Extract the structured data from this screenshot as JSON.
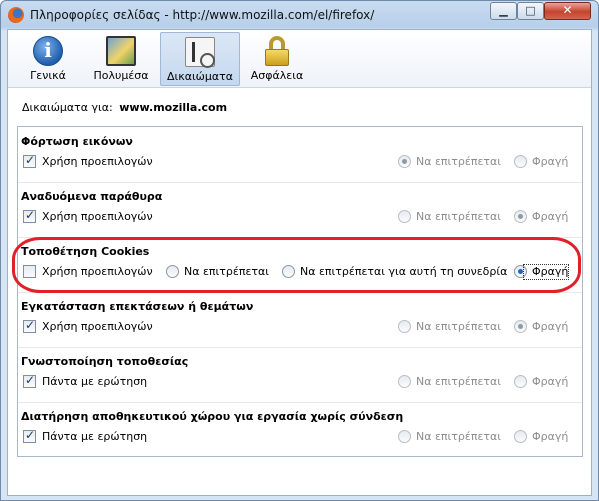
{
  "window": {
    "title": "Πληροφορίες σελίδας - http://www.mozilla.com/el/firefox/",
    "minimize_icon": "minimize-icon",
    "maximize_icon": "maximize-icon",
    "close_icon": "close-icon"
  },
  "toolbar": {
    "tabs": [
      {
        "label": "Γενικά",
        "icon": "info-icon"
      },
      {
        "label": "Πολυμέσα",
        "icon": "media-icon"
      },
      {
        "label": "Δικαιώματα",
        "icon": "permissions-icon",
        "active": true
      },
      {
        "label": "Ασφάλεια",
        "icon": "lock-icon"
      }
    ]
  },
  "permissions": {
    "header_label": "Δικαιώματα για:",
    "site": "www.mozilla.com",
    "sections": [
      {
        "title": "Φόρτωση εικόνων",
        "checkbox_label": "Χρήση προεπιλογών",
        "checked": true,
        "options": [
          "Να επιτρέπεται",
          "Φραγή"
        ],
        "selected": "Να επιτρέπεται"
      },
      {
        "title": "Αναδυόμενα παράθυρα",
        "checkbox_label": "Χρήση προεπιλογών",
        "checked": true,
        "options": [
          "Να επιτρέπεται",
          "Φραγή"
        ],
        "selected": "Φραγή"
      },
      {
        "title": "Τοποθέτηση Cookies",
        "checkbox_label": "Χρήση προεπιλογών",
        "checked": false,
        "options": [
          "Να επιτρέπεται",
          "Να επιτρέπεται για αυτή τη συνεδρία",
          "Φραγή"
        ],
        "selected": "Φραγή"
      },
      {
        "title": "Εγκατάσταση επεκτάσεων ή θεμάτων",
        "checkbox_label": "Χρήση προεπιλογών",
        "checked": true,
        "options": [
          "Να επιτρέπεται",
          "Φραγή"
        ],
        "selected": "Φραγή"
      },
      {
        "title": "Γνωστοποίηση τοποθεσίας",
        "checkbox_label": "Πάντα με ερώτηση",
        "checked": true,
        "options": [
          "Να επιτρέπεται",
          "Φραγή"
        ],
        "selected": null
      },
      {
        "title": "Διατήρηση αποθηκευτικού χώρου για εργασία χωρίς σύνδεση",
        "checkbox_label": "Πάντα με ερώτηση",
        "checked": true,
        "options": [
          "Να επιτρέπεται",
          "Φραγή"
        ],
        "selected": null
      }
    ]
  },
  "colors": {
    "highlight_outline": "#e2202a",
    "radio_selected": "#2563c6"
  }
}
